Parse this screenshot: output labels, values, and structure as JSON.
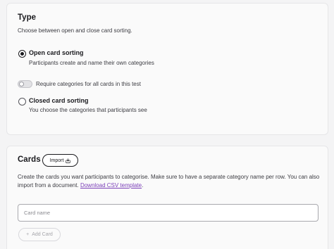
{
  "type_section": {
    "title": "Type",
    "subtitle": "Choose between open and close card sorting.",
    "options": [
      {
        "label": "Open card sorting",
        "description": "Participants create and name their own categories",
        "selected": true
      },
      {
        "label": "Closed card sorting",
        "description": "You choose the categories that participants see",
        "selected": false
      }
    ],
    "toggle": {
      "label": "Require categories for all cards in this test",
      "on": false
    }
  },
  "cards_section": {
    "title": "Cards",
    "import_label": "Import",
    "description": "Create the cards you want participants to categorise. Make sure to have a separate category name per row. You can also import from a document.",
    "template_link": "Download CSV template",
    "description_end": ".",
    "input_placeholder": "Card name",
    "input_value": "",
    "add_label": "Add Card"
  },
  "colors": {
    "link": "#7b3fb8",
    "text": "#1a1a1e",
    "muted": "#3c3c42"
  },
  "icons": {
    "import": "import-icon",
    "add": "plus-icon"
  }
}
